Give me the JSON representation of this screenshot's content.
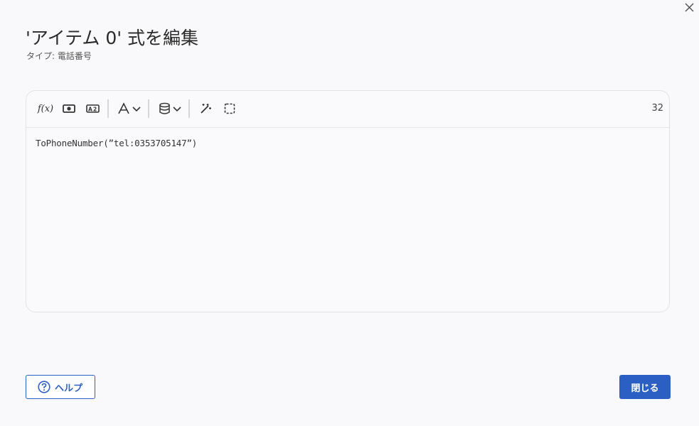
{
  "dialog": {
    "title": "'アイテム 0' 式を編集",
    "subtitle": "タイプ: 電話番号",
    "close_icon": "close-icon"
  },
  "editor": {
    "char_count": "32",
    "code": "ToPhoneNumber(”tel:0353705147”)",
    "toolbar": {
      "function_label": "f(x)",
      "icons": [
        "function-icon",
        "currency-icon",
        "text-field-icon",
        "font-icon",
        "chevron-down-icon",
        "database-icon",
        "chevron-down-icon",
        "magic-wand-icon",
        "select-area-icon"
      ]
    }
  },
  "footer": {
    "help_label": "ヘルプ",
    "close_label": "閉じる"
  },
  "colors": {
    "primary": "#2b5fc4",
    "background": "#f9f9fb"
  }
}
